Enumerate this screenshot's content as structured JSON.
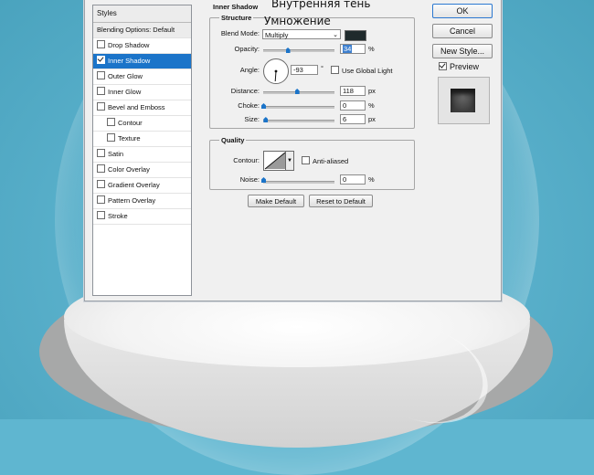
{
  "styles_panel": {
    "header": "Styles",
    "items": [
      {
        "label": "Blending Options: Default",
        "checkbox": false,
        "checked": false,
        "indent": false
      },
      {
        "label": "Drop Shadow",
        "checkbox": true,
        "checked": false,
        "indent": false
      },
      {
        "label": "Inner Shadow",
        "checkbox": true,
        "checked": true,
        "indent": false,
        "selected": true
      },
      {
        "label": "Outer Glow",
        "checkbox": true,
        "checked": false,
        "indent": false
      },
      {
        "label": "Inner Glow",
        "checkbox": true,
        "checked": false,
        "indent": false
      },
      {
        "label": "Bevel and Emboss",
        "checkbox": true,
        "checked": false,
        "indent": false
      },
      {
        "label": "Contour",
        "checkbox": true,
        "checked": false,
        "indent": true
      },
      {
        "label": "Texture",
        "checkbox": true,
        "checked": false,
        "indent": true
      },
      {
        "label": "Satin",
        "checkbox": true,
        "checked": false,
        "indent": false
      },
      {
        "label": "Color Overlay",
        "checkbox": true,
        "checked": false,
        "indent": false
      },
      {
        "label": "Gradient Overlay",
        "checkbox": true,
        "checked": false,
        "indent": false
      },
      {
        "label": "Pattern Overlay",
        "checkbox": true,
        "checked": false,
        "indent": false
      },
      {
        "label": "Stroke",
        "checkbox": true,
        "checked": false,
        "indent": false
      }
    ]
  },
  "inner_shadow": {
    "title": "Inner Shadow",
    "annotation_title": "Внутренняя тень",
    "structure": {
      "legend": "Structure",
      "annotation_blend": "Умножение",
      "blend_mode_label": "Blend Mode:",
      "blend_mode_value": "Multiply",
      "color": "#1f2a2c",
      "opacity_label": "Opacity:",
      "opacity_value": "34",
      "opacity_unit": "%",
      "opacity_level": 0.34,
      "angle_label": "Angle:",
      "angle_value": "-93",
      "angle_unit": "°",
      "use_global_light_label": "Use Global Light",
      "distance_label": "Distance:",
      "distance_value": "118",
      "distance_unit": "px",
      "distance_level": 0.47,
      "choke_label": "Choke:",
      "choke_value": "0",
      "choke_unit": "%",
      "choke_level": 0.0,
      "size_label": "Size:",
      "size_value": "6",
      "size_unit": "px",
      "size_level": 0.03
    },
    "quality": {
      "legend": "Quality",
      "contour_label": "Contour:",
      "anti_aliased_label": "Anti-aliased",
      "noise_label": "Noise:",
      "noise_value": "0",
      "noise_unit": "%",
      "noise_level": 0.0
    },
    "make_default_label": "Make Default",
    "reset_default_label": "Reset to Default"
  },
  "right_buttons": {
    "ok_label": "OK",
    "cancel_label": "Cancel",
    "new_style_label": "New Style...",
    "preview_label": "Preview",
    "preview_checked": true
  }
}
